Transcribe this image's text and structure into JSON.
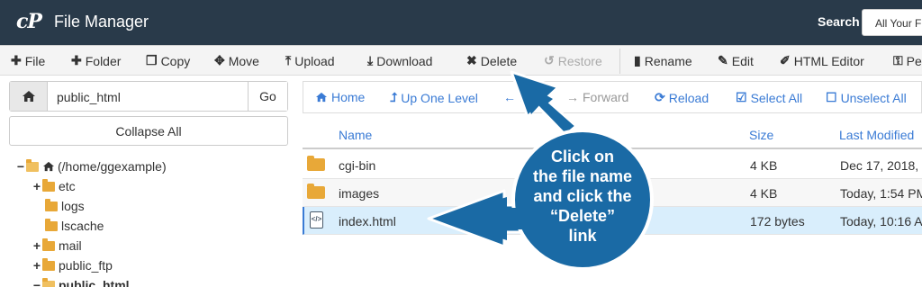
{
  "header": {
    "logo": "cP",
    "title": "File Manager",
    "search_label": "Search",
    "search_scope": "All Your F"
  },
  "toolbar": {
    "file": "File",
    "folder": "Folder",
    "copy": "Copy",
    "move": "Move",
    "upload": "Upload",
    "download": "Download",
    "delete": "Delete",
    "restore": "Restore",
    "rename": "Rename",
    "edit": "Edit",
    "html_editor": "HTML Editor",
    "permissions": "Pe"
  },
  "path_bar": {
    "value": "public_html",
    "go": "Go"
  },
  "sidebar": {
    "collapse_all": "Collapse All",
    "tree": [
      {
        "label": "(/home/ggexample)"
      },
      {
        "label": "etc"
      },
      {
        "label": "logs"
      },
      {
        "label": "lscache"
      },
      {
        "label": "mail"
      },
      {
        "label": "public_ftp"
      },
      {
        "label": "public_html"
      }
    ]
  },
  "nav": {
    "home": "Home",
    "up": "Up One Level",
    "back": "Back",
    "forward": "Forward",
    "reload": "Reload",
    "select_all": "Select All",
    "unselect_all": "Unselect All"
  },
  "table": {
    "columns": {
      "name": "Name",
      "size": "Size",
      "modified": "Last Modified"
    },
    "rows": [
      {
        "name": "cgi-bin",
        "size": "4 KB",
        "modified": "Dec 17, 2018,"
      },
      {
        "name": "images",
        "size": "4 KB",
        "modified": "Today, 1:54 PM"
      },
      {
        "name": "index.html",
        "size": "172 bytes",
        "modified": "Today, 10:16 A"
      }
    ]
  },
  "annotation": {
    "lines": [
      "Click on",
      "the file name",
      "and click the",
      "“Delete”",
      "link"
    ],
    "color": "#1a6aa5"
  },
  "colors": {
    "header_bg": "#293a4a",
    "link_blue": "#3a7bd5",
    "folder": "#e8a838",
    "selected_row": "#d9eefc"
  }
}
